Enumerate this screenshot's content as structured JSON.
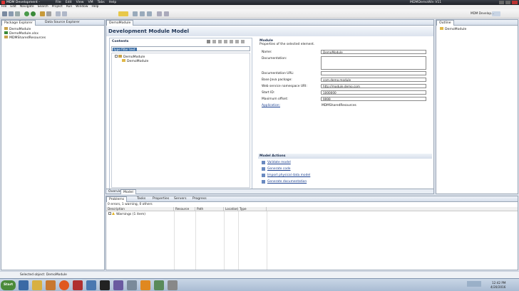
{
  "window": {
    "title": "MDM Development - ",
    "right_title": "MDMDemoWin V11"
  },
  "menu": [
    "File",
    "Edit",
    "Navigate",
    "Search",
    "Project",
    "Run",
    "Window",
    "Help"
  ],
  "menu_right": [
    "File",
    "Edit",
    "View",
    "VM",
    "Tabs",
    "Help"
  ],
  "left": {
    "tabs": [
      "Package Explorer",
      "Data Source Explorer"
    ],
    "items": [
      "DemoModule",
      "DemoModule.xlsx",
      "MDMSharedResources"
    ]
  },
  "editor": {
    "tab": "DemoModule",
    "heading": "Development Module Model",
    "contents": {
      "title": "Contents",
      "filter": "type filter text",
      "tree": [
        "DemoModule",
        "DemoModule"
      ]
    },
    "module": {
      "title": "Module",
      "subtitle": "Properties of the selected element.",
      "fields": [
        {
          "label": "Name:",
          "value": "DemoModule"
        },
        {
          "label": "Documentation:",
          "value": ""
        },
        {
          "label": "Documentation URL:",
          "value": ""
        },
        {
          "label": "Base Java package:",
          "value": "com.demo.module"
        },
        {
          "label": "Web service namespace URI:",
          "value": "http://module.demo.com"
        },
        {
          "label": "Start ID:",
          "value": "1000000"
        },
        {
          "label": "Maximum offset:",
          "value": "9999"
        }
      ],
      "application_label": "Application:",
      "application_value": "MDMSharedResources"
    },
    "actions": {
      "title": "Model Actions",
      "items": [
        "Validate model",
        "Generate code",
        "Import physical data model",
        "Generate documentation"
      ]
    },
    "bottom_tabs": [
      "Overview",
      "Model"
    ]
  },
  "outline": {
    "tab": "Outline",
    "items": [
      "DemoModule"
    ],
    "right_label": "MDM Develop..."
  },
  "problems": {
    "tabs": [
      "Problems",
      "Tasks",
      "Properties",
      "Servers",
      "Progress"
    ],
    "summary": "0 errors, 1 warning, 0 others",
    "columns": [
      "Description",
      "Resource",
      "Path",
      "Location",
      "Type"
    ],
    "rows": [
      "Warnings (1 item)"
    ]
  },
  "status": "Selected object: DemoModule",
  "taskbar": {
    "start": "Start",
    "time": "12:42 PM",
    "date": "4/20/2016"
  },
  "colors": {
    "accent": "#3b6ea5",
    "title_bg": "#1e2228",
    "link": "#1a3f8f"
  }
}
